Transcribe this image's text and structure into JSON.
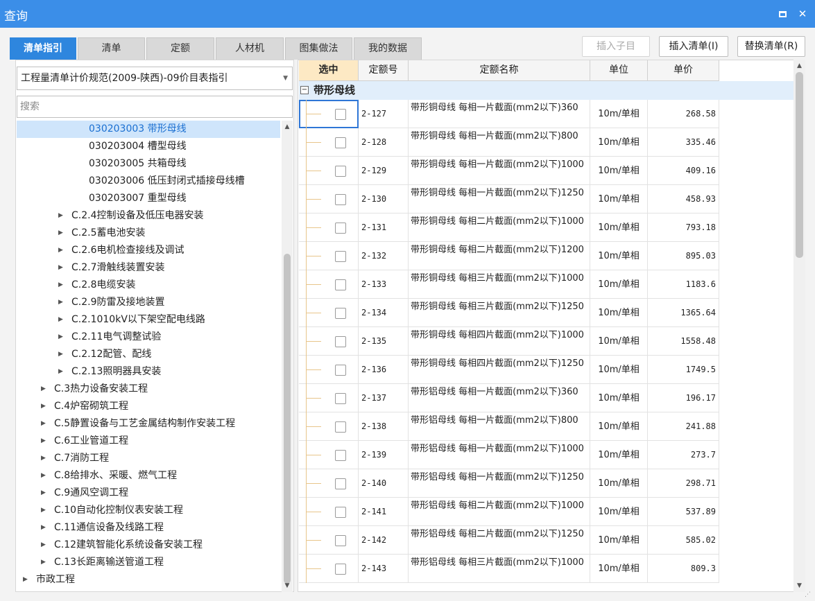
{
  "window": {
    "title": "查询"
  },
  "tabs": [
    {
      "label": "清单指引",
      "active": true
    },
    {
      "label": "清单"
    },
    {
      "label": "定额"
    },
    {
      "label": "人材机"
    },
    {
      "label": "图集做法"
    },
    {
      "label": "我的数据"
    }
  ],
  "toolbar": {
    "insert_child_label": "插入子目",
    "insert_list_label": "插入清单(I)",
    "replace_list_label": "替换清单(R)"
  },
  "left": {
    "combo_value": "工程量清单计价规范(2009-陕西)-09价目表指引",
    "search_placeholder": "搜索",
    "tree": [
      {
        "label": "030203003  带形母线",
        "level": 3,
        "selected": true
      },
      {
        "label": "030203004  槽型母线",
        "level": 3
      },
      {
        "label": "030203005  共箱母线",
        "level": 3
      },
      {
        "label": "030203006  低压封闭式插接母线槽",
        "level": 3
      },
      {
        "label": "030203007  重型母线",
        "level": 3
      },
      {
        "label": "C.2.4控制设备及低压电器安装",
        "level": 2
      },
      {
        "label": "C.2.5蓄电池安装",
        "level": 2
      },
      {
        "label": "C.2.6电机检查接线及调试",
        "level": 2
      },
      {
        "label": "C.2.7滑触线装置安装",
        "level": 2
      },
      {
        "label": "C.2.8电缆安装",
        "level": 2
      },
      {
        "label": "C.2.9防雷及接地装置",
        "level": 2
      },
      {
        "label": "C.2.1010kV以下架空配电线路",
        "level": 2
      },
      {
        "label": "C.2.11电气调整试验",
        "level": 2
      },
      {
        "label": "C.2.12配管、配线",
        "level": 2
      },
      {
        "label": "C.2.13照明器具安装",
        "level": 2
      },
      {
        "label": "C.3热力设备安装工程",
        "level": 1
      },
      {
        "label": "C.4炉窑砌筑工程",
        "level": 1
      },
      {
        "label": "C.5静置设备与工艺金属结构制作安装工程",
        "level": 1
      },
      {
        "label": "C.6工业管道工程",
        "level": 1
      },
      {
        "label": "C.7消防工程",
        "level": 1
      },
      {
        "label": "C.8给排水、采暖、燃气工程",
        "level": 1
      },
      {
        "label": "C.9通风空调工程",
        "level": 1
      },
      {
        "label": "C.10自动化控制仪表安装工程",
        "level": 1
      },
      {
        "label": "C.11通信设备及线路工程",
        "level": 1
      },
      {
        "label": "C.12建筑智能化系统设备安装工程",
        "level": 1
      },
      {
        "label": "C.13长距离输送管道工程",
        "level": 1
      },
      {
        "label": "市政工程",
        "level": 0
      }
    ]
  },
  "grid": {
    "headers": [
      "选中",
      "定额号",
      "定额名称",
      "单位",
      "单价"
    ],
    "group_label": "带形母线",
    "rows": [
      {
        "code": "2-127",
        "name": "带形铜母线 每相一片截面(mm2以下)360",
        "unit": "10m/单相",
        "price": "268.58"
      },
      {
        "code": "2-128",
        "name": "带形铜母线 每相一片截面(mm2以下)800",
        "unit": "10m/单相",
        "price": "335.46"
      },
      {
        "code": "2-129",
        "name": "带形铜母线 每相一片截面(mm2以下)1000",
        "unit": "10m/单相",
        "price": "409.16"
      },
      {
        "code": "2-130",
        "name": "带形铜母线 每相一片截面(mm2以下)1250",
        "unit": "10m/单相",
        "price": "458.93"
      },
      {
        "code": "2-131",
        "name": "带形铜母线 每相二片截面(mm2以下)1000",
        "unit": "10m/单相",
        "price": "793.18"
      },
      {
        "code": "2-132",
        "name": "带形铜母线 每相二片截面(mm2以下)1200",
        "unit": "10m/单相",
        "price": "895.03"
      },
      {
        "code": "2-133",
        "name": "带形铜母线 每相三片截面(mm2以下)1000",
        "unit": "10m/单相",
        "price": "1183.6"
      },
      {
        "code": "2-134",
        "name": "带形铜母线 每相三片截面(mm2以下)1250",
        "unit": "10m/单相",
        "price": "1365.64"
      },
      {
        "code": "2-135",
        "name": "带形铜母线 每相四片截面(mm2以下)1000",
        "unit": "10m/单相",
        "price": "1558.48"
      },
      {
        "code": "2-136",
        "name": "带形铜母线 每相四片截面(mm2以下)1250",
        "unit": "10m/单相",
        "price": "1749.5"
      },
      {
        "code": "2-137",
        "name": "带形铝母线 每相一片截面(mm2以下)360",
        "unit": "10m/单相",
        "price": "196.17"
      },
      {
        "code": "2-138",
        "name": "带形铝母线 每相一片截面(mm2以下)800",
        "unit": "10m/单相",
        "price": "241.88"
      },
      {
        "code": "2-139",
        "name": "带形铝母线 每相一片截面(mm2以下)1000",
        "unit": "10m/单相",
        "price": "273.7"
      },
      {
        "code": "2-140",
        "name": "带形铝母线 每相一片截面(mm2以下)1250",
        "unit": "10m/单相",
        "price": "298.71"
      },
      {
        "code": "2-141",
        "name": "带形铝母线 每相二片截面(mm2以下)1000",
        "unit": "10m/单相",
        "price": "537.89"
      },
      {
        "code": "2-142",
        "name": "带形铝母线 每相二片截面(mm2以下)1250",
        "unit": "10m/单相",
        "price": "585.02"
      },
      {
        "code": "2-143",
        "name": "带形铝母线 每相三片截面(mm2以下)1000",
        "unit": "10m/单相",
        "price": "809.3"
      }
    ]
  },
  "colors": {
    "titlebar": "#3b8ee8",
    "active_tab": "#2e86de",
    "selected_tree_bg": "#cfe5fb",
    "selected_header_bg": "#fde9c4",
    "group_row_bg": "#e1eefb"
  }
}
